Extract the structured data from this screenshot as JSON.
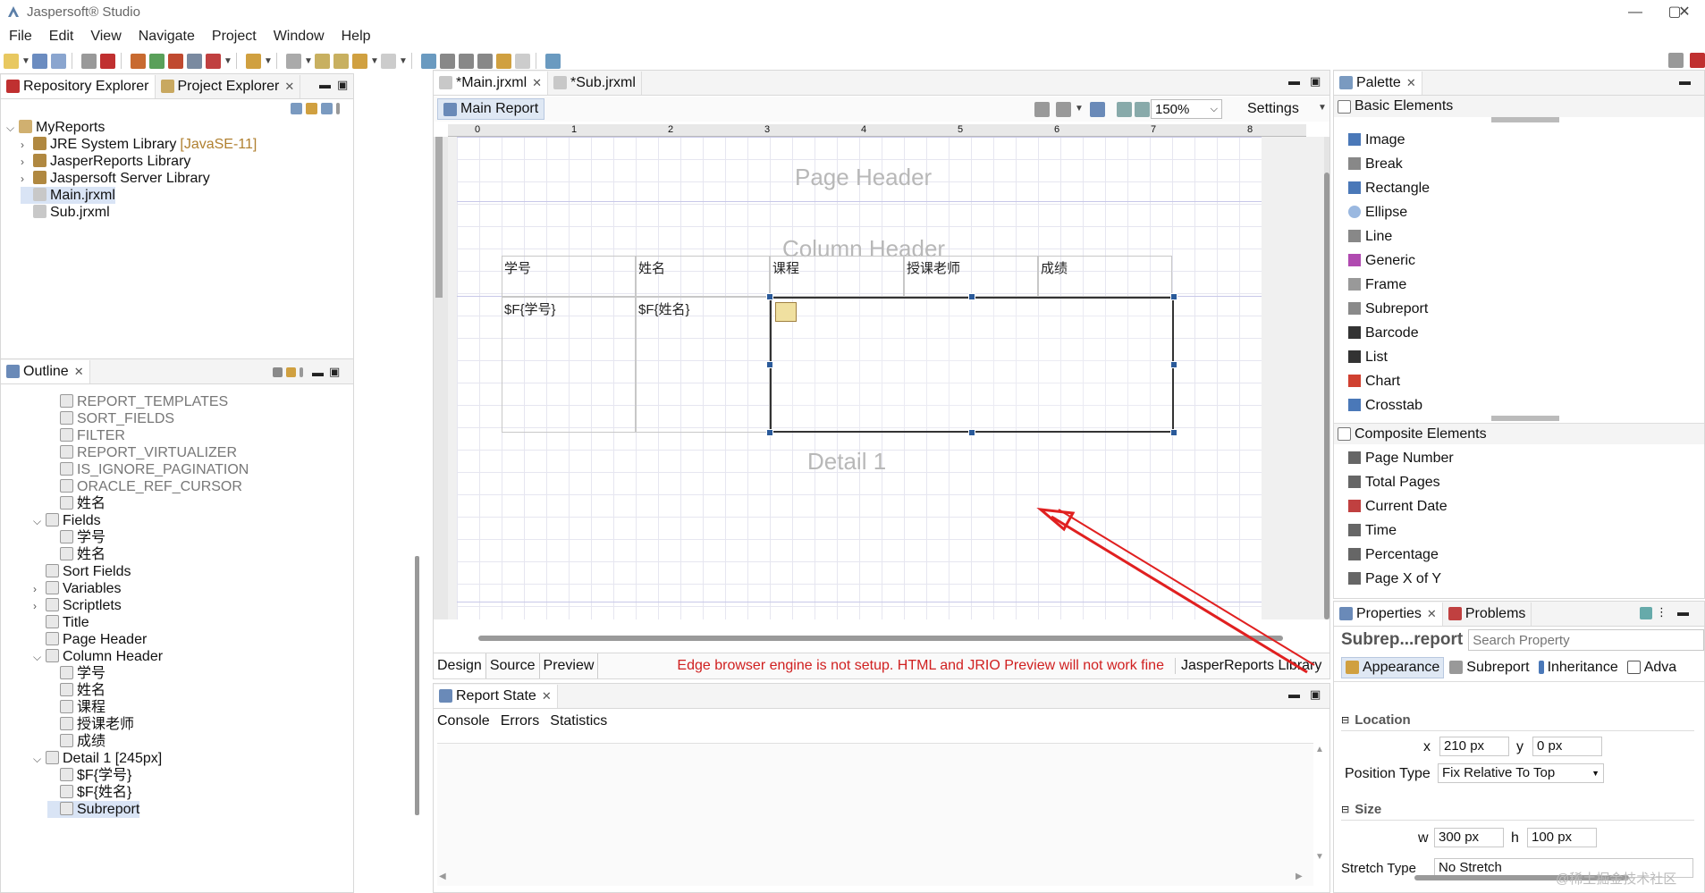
{
  "window": {
    "title": "Jaspersoft® Studio",
    "min": "—",
    "max": "▢",
    "close": "✕"
  },
  "menu": [
    "File",
    "Edit",
    "View",
    "Navigate",
    "Project",
    "Window",
    "Help"
  ],
  "left_top": {
    "tabs": [
      {
        "label": "Repository Explorer"
      },
      {
        "label": "Project Explorer"
      }
    ],
    "tree": [
      {
        "label": "MyReports",
        "extra": "",
        "twisty": "⌵",
        "indent": 0
      },
      {
        "label": "JRE System Library",
        "extra": "[JavaSE-11]",
        "twisty": "›",
        "indent": 1
      },
      {
        "label": "JasperReports Library",
        "extra": "",
        "twisty": "›",
        "indent": 1
      },
      {
        "label": "Jaspersoft Server Library",
        "extra": "",
        "twisty": "›",
        "indent": 1
      },
      {
        "label": "Main.jrxml",
        "extra": "",
        "twisty": "",
        "indent": 1,
        "selected": true
      },
      {
        "label": "Sub.jrxml",
        "extra": "",
        "twisty": "",
        "indent": 1
      }
    ]
  },
  "outline": {
    "title": "Outline",
    "items": [
      {
        "label": "REPORT_TEMPLATES",
        "gray": true,
        "twisty": "",
        "indent": 2
      },
      {
        "label": "SORT_FIELDS",
        "gray": true,
        "twisty": "",
        "indent": 2
      },
      {
        "label": "FILTER",
        "gray": true,
        "twisty": "",
        "indent": 2
      },
      {
        "label": "REPORT_VIRTUALIZER",
        "gray": true,
        "twisty": "",
        "indent": 2
      },
      {
        "label": "IS_IGNORE_PAGINATION",
        "gray": true,
        "twisty": "",
        "indent": 2
      },
      {
        "label": "ORACLE_REF_CURSOR",
        "gray": true,
        "twisty": "",
        "indent": 2
      },
      {
        "label": "姓名",
        "gray": false,
        "twisty": "",
        "indent": 2
      },
      {
        "label": "Fields",
        "gray": false,
        "twisty": "⌵",
        "indent": 1
      },
      {
        "label": "学号",
        "gray": false,
        "twisty": "",
        "indent": 2
      },
      {
        "label": "姓名",
        "gray": false,
        "twisty": "",
        "indent": 2
      },
      {
        "label": "Sort Fields",
        "gray": false,
        "twisty": "",
        "indent": 1
      },
      {
        "label": "Variables",
        "gray": false,
        "twisty": "›",
        "indent": 1
      },
      {
        "label": "Scriptlets",
        "gray": false,
        "twisty": "›",
        "indent": 1
      },
      {
        "label": "Title",
        "gray": false,
        "twisty": "",
        "indent": 1
      },
      {
        "label": "Page Header",
        "gray": false,
        "twisty": "",
        "indent": 1
      },
      {
        "label": "Column Header",
        "gray": false,
        "twisty": "⌵",
        "indent": 1
      },
      {
        "label": "学号",
        "gray": false,
        "twisty": "",
        "indent": 2
      },
      {
        "label": "姓名",
        "gray": false,
        "twisty": "",
        "indent": 2
      },
      {
        "label": "课程",
        "gray": false,
        "twisty": "",
        "indent": 2
      },
      {
        "label": "授课老师",
        "gray": false,
        "twisty": "",
        "indent": 2
      },
      {
        "label": "成绩",
        "gray": false,
        "twisty": "",
        "indent": 2
      },
      {
        "label": "Detail 1 [245px]",
        "gray": false,
        "twisty": "⌵",
        "indent": 1
      },
      {
        "label": "$F{学号}",
        "gray": false,
        "twisty": "",
        "indent": 2
      },
      {
        "label": "$F{姓名}",
        "gray": false,
        "twisty": "",
        "indent": 2
      },
      {
        "label": "Subreport",
        "gray": false,
        "twisty": "",
        "indent": 2,
        "selected": true
      }
    ]
  },
  "editor": {
    "tabs": [
      {
        "label": "*Main.jrxml"
      },
      {
        "label": "*Sub.jrxml"
      }
    ],
    "subtab": "Main Report",
    "zoom": "150%",
    "settings": "Settings",
    "ruler": [
      "0",
      "1",
      "2",
      "3",
      "4",
      "5",
      "6",
      "7",
      "8"
    ],
    "bands": {
      "page_header": "Page Header",
      "column_header": "Column Header",
      "detail": "Detail 1"
    },
    "headers": [
      "学号",
      "姓名",
      "课程",
      "授课老师",
      "成绩"
    ],
    "fields": [
      "$F{学号}",
      "$F{姓名}"
    ],
    "bottom_tabs": [
      "Design",
      "Source",
      "Preview"
    ],
    "warning": "Edge browser engine is not setup. HTML and JRIO Preview will not work fine",
    "lib": "JasperReports Library"
  },
  "report_state": {
    "title": "Report State",
    "tabs": [
      "Console",
      "Errors",
      "Statistics"
    ]
  },
  "palette": {
    "title": "Palette",
    "basic_title": "Basic Elements",
    "basic": [
      {
        "label": "Image",
        "icon": "image-icon",
        "color": "#4a78b8"
      },
      {
        "label": "Break",
        "icon": "break-icon",
        "color": "#888"
      },
      {
        "label": "Rectangle",
        "icon": "rectangle-icon",
        "color": "#4a78b8"
      },
      {
        "label": "Ellipse",
        "icon": "ellipse-icon",
        "color": "#9ab8e0"
      },
      {
        "label": "Line",
        "icon": "line-icon",
        "color": "#888"
      },
      {
        "label": "Generic",
        "icon": "generic-icon",
        "color": "#b04ab0"
      },
      {
        "label": "Frame",
        "icon": "frame-icon",
        "color": "#999"
      },
      {
        "label": "Subreport",
        "icon": "subreport-icon",
        "color": "#8a8a8a"
      },
      {
        "label": "Barcode",
        "icon": "barcode-icon",
        "color": "#333"
      },
      {
        "label": "List",
        "icon": "list-icon",
        "color": "#333"
      },
      {
        "label": "Chart",
        "icon": "chart-icon",
        "color": "#d04030"
      },
      {
        "label": "Crosstab",
        "icon": "crosstab-icon",
        "color": "#4a78b8"
      }
    ],
    "composite_title": "Composite Elements",
    "composite": [
      {
        "label": "Page Number",
        "icon": "page-number-icon",
        "color": "#666"
      },
      {
        "label": "Total Pages",
        "icon": "total-pages-icon",
        "color": "#666"
      },
      {
        "label": "Current Date",
        "icon": "current-date-icon",
        "color": "#c04040"
      },
      {
        "label": "Time",
        "icon": "time-icon",
        "color": "#666"
      },
      {
        "label": "Percentage",
        "icon": "percentage-icon",
        "color": "#666"
      },
      {
        "label": "Page X of Y",
        "icon": "page-x-of-y-icon",
        "color": "#666"
      }
    ]
  },
  "properties": {
    "tabs": [
      {
        "label": "Properties"
      },
      {
        "label": "Problems"
      }
    ],
    "heading": "Subrep...report",
    "search_placeholder": "Search Property",
    "subtabs": [
      "Appearance",
      "Subreport",
      "Inheritance",
      "Adva"
    ],
    "location_title": "Location",
    "x_label": "x",
    "x_value": "210 px",
    "y_label": "y",
    "y_value": "0 px",
    "pos_type_label": "Position Type",
    "pos_type_value": "Fix Relative To Top",
    "size_title": "Size",
    "w_label": "w",
    "w_value": "300 px",
    "h_label": "h",
    "h_value": "100 px",
    "stretch_label": "Stretch Type",
    "stretch_value": "No Stretch"
  },
  "watermark": "@稀土掘金技术社区"
}
